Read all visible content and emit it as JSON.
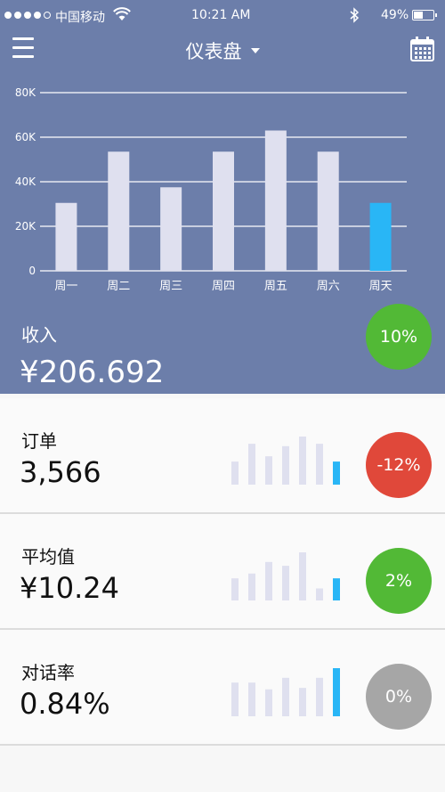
{
  "status_bar": {
    "carrier": "中国移动",
    "time": "10:21 AM",
    "battery": "49%",
    "battery_level": 0.49
  },
  "nav": {
    "title": "仪表盘",
    "menu_icon": "hamburger-menu-icon",
    "title_caret_icon": "caret-down-icon",
    "calendar_icon": "calendar-icon"
  },
  "colors": {
    "header_bg": "#6c7eaa",
    "bar_default": "#dfe0ef",
    "bar_highlight": "#29b6f6",
    "positive": "#52b936",
    "negative": "#e0483a",
    "neutral": "#a6a6a6"
  },
  "chart_data": {
    "type": "bar",
    "categories": [
      "周一",
      "周二",
      "周三",
      "周四",
      "周五",
      "周六",
      "周天"
    ],
    "values": [
      30500,
      53500,
      37500,
      53500,
      63000,
      53500,
      30500
    ],
    "y_ticks": [
      "0",
      "20K",
      "40K",
      "60K",
      "80K"
    ],
    "ylim": [
      0,
      80000
    ],
    "highlight_index": 6,
    "grid": true
  },
  "revenue": {
    "label": "收入",
    "value": "¥206.692",
    "change": "10%"
  },
  "cards": [
    {
      "label": "订单",
      "value": "3,566",
      "change": "-12%",
      "trend": "negative",
      "spark": [
        0.48,
        0.85,
        0.59,
        0.8,
        1.0,
        0.85,
        0.48
      ]
    },
    {
      "label": "平均值",
      "value": "¥10.24",
      "change": "2%",
      "trend": "positive",
      "spark": [
        0.46,
        0.56,
        0.8,
        0.72,
        1.0,
        0.25,
        0.46
      ]
    },
    {
      "label": "对话率",
      "value": "0.84%",
      "change": "0%",
      "trend": "neutral",
      "spark": [
        0.7,
        0.7,
        0.56,
        0.8,
        0.59,
        0.8,
        1.0
      ]
    }
  ]
}
